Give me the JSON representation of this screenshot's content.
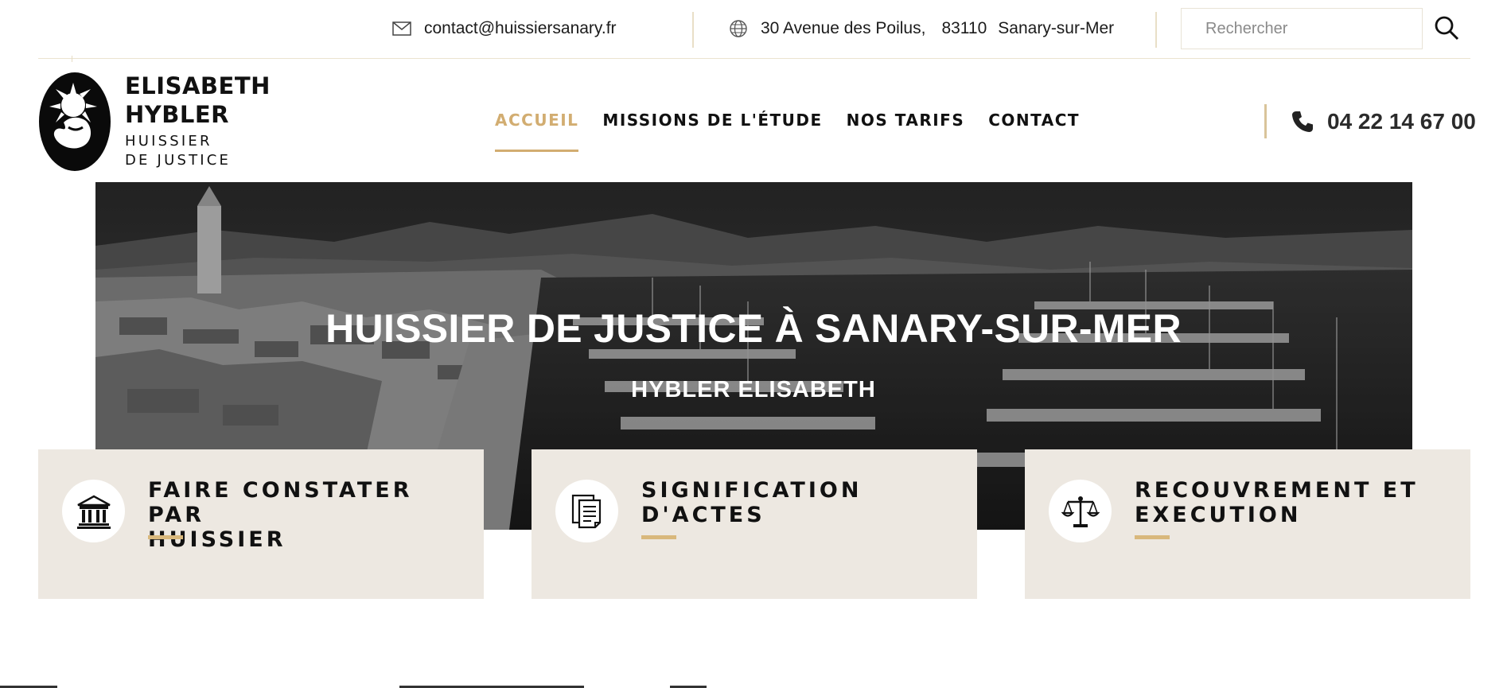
{
  "topbar": {
    "email": "contact@huissiersanary.fr",
    "address_street": "30 Avenue des Poilus,",
    "address_zip": "83110",
    "address_city": "Sanary-sur-Mer",
    "search_placeholder": "Rechercher",
    "email_icon": "envelope-icon",
    "address_icon": "globe-icon",
    "search_icon": "magnifier-icon"
  },
  "brand": {
    "name_line1": "ELISABETH",
    "name_line2": "HYBLER",
    "sub_line1": "HUISSIER",
    "sub_line2": "DE JUSTICE"
  },
  "nav": {
    "items": [
      {
        "label": "ACCUEIL",
        "active": true
      },
      {
        "label": "MISSIONS DE L'ÉTUDE",
        "active": false
      },
      {
        "label": "NOS TARIFS",
        "active": false
      },
      {
        "label": "CONTACT",
        "active": false
      }
    ]
  },
  "phone": {
    "number": "04 22 14 67 00",
    "icon": "phone-icon"
  },
  "hero": {
    "title": "HUISSIER DE JUSTICE À SANARY-SUR-MER",
    "subtitle": "HYBLER ELISABETH"
  },
  "cards": [
    {
      "title_line1": "FAIRE CONSTATER PAR",
      "title_line2": "HUISSIER",
      "icon": "courthouse-icon"
    },
    {
      "title_line1": "SIGNIFICATION",
      "title_line2": "D'ACTES",
      "icon": "documents-icon"
    },
    {
      "title_line1": "RECOUVREMENT ET",
      "title_line2": "EXECUTION",
      "icon": "scales-icon"
    }
  ],
  "colors": {
    "accent": "#d2ad71",
    "card_bg": "#ede8e1",
    "text": "#111111"
  }
}
